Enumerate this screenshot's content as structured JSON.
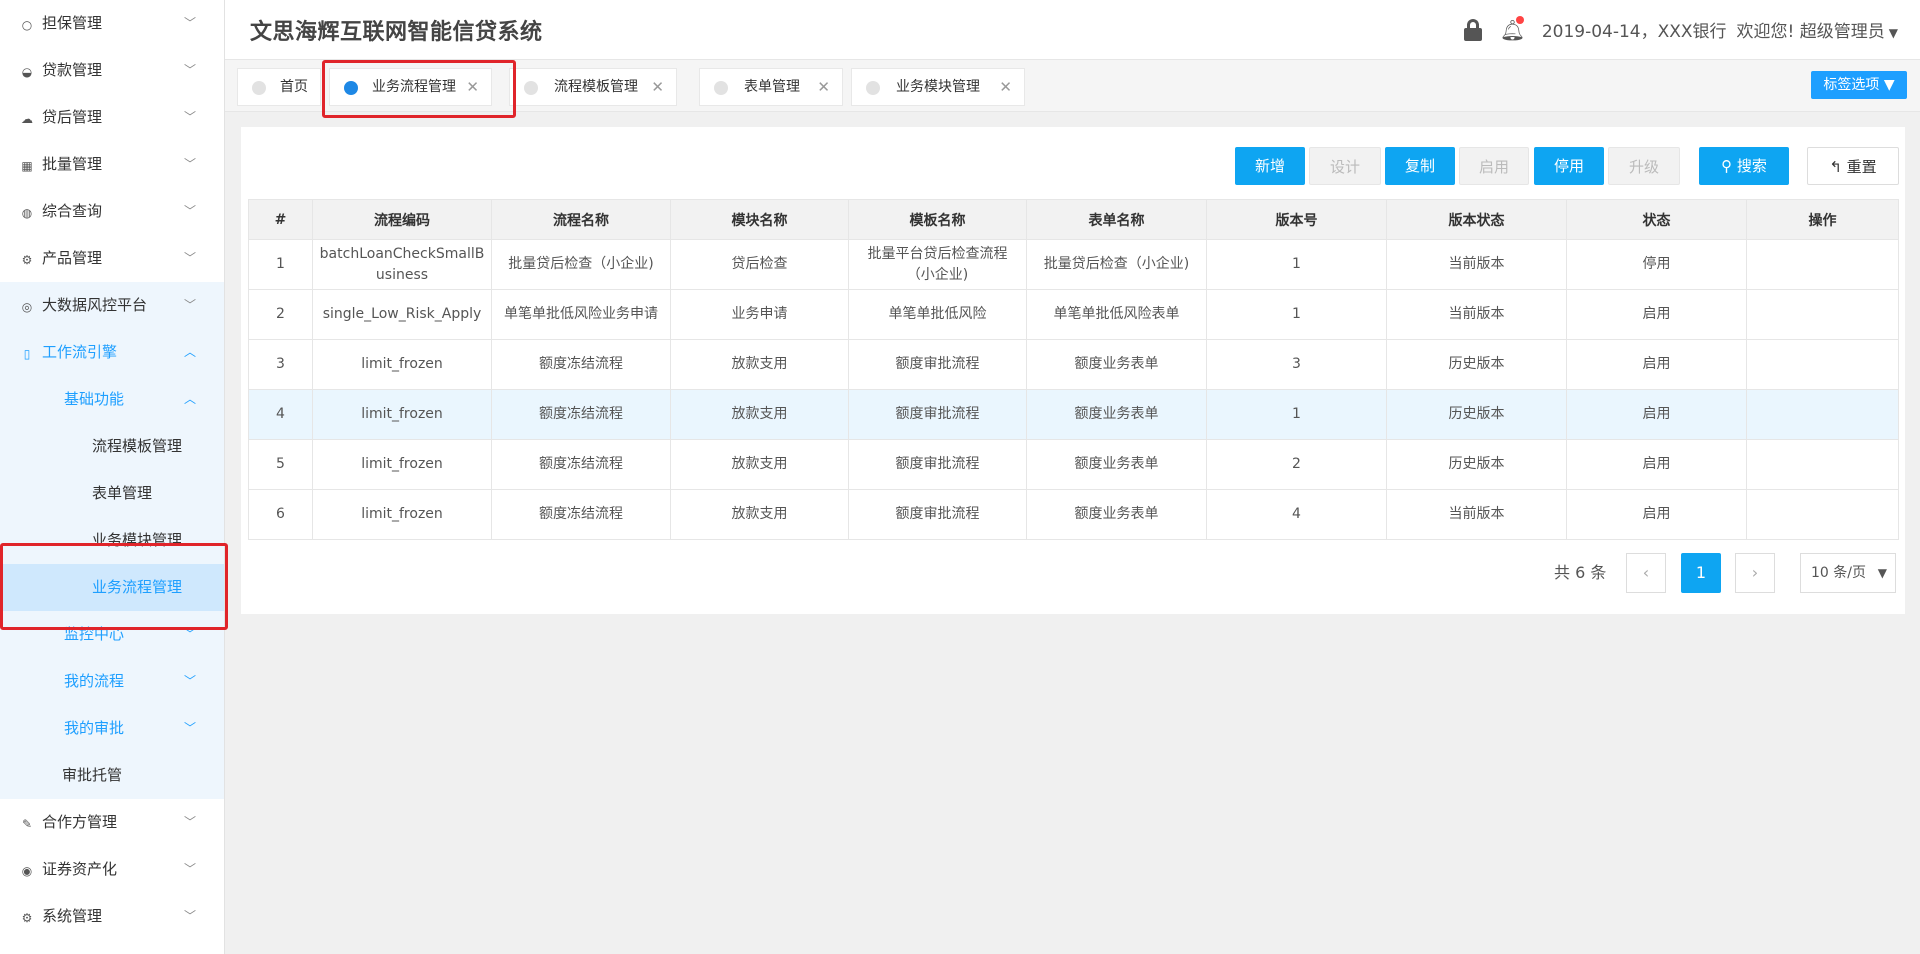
{
  "header": {
    "app_title": "文思海辉互联网智能信贷系统",
    "date_bank": "2019-04-14，XXX银行",
    "welcome": "欢迎您! 超级管理员"
  },
  "sidebar": {
    "items": [
      {
        "label": "担保管理",
        "icon": "circle-outline-icon"
      },
      {
        "label": "贷款管理",
        "icon": "half-circle-icon"
      },
      {
        "label": "贷后管理",
        "icon": "cloud-icon"
      },
      {
        "label": "批量管理",
        "icon": "grid-icon"
      },
      {
        "label": "综合查询",
        "icon": "globe-icon"
      },
      {
        "label": "产品管理",
        "icon": "gear-icon"
      },
      {
        "label": "大数据风控平台",
        "icon": "signal-icon"
      },
      {
        "label": "工作流引擎",
        "icon": "mobile-icon"
      },
      {
        "label": "基础功能"
      },
      {
        "label": "流程模板管理"
      },
      {
        "label": "表单管理"
      },
      {
        "label": "业务模块管理"
      },
      {
        "label": "业务流程管理"
      },
      {
        "label": "监控中心"
      },
      {
        "label": "我的流程"
      },
      {
        "label": "我的审批"
      },
      {
        "label": "审批托管"
      },
      {
        "label": "合作方管理",
        "icon": "brush-icon"
      },
      {
        "label": "证券资产化",
        "icon": "radio-icon"
      },
      {
        "label": "系统管理",
        "icon": "gear-icon"
      }
    ]
  },
  "tabs": [
    {
      "label": "首页"
    },
    {
      "label": "业务流程管理"
    },
    {
      "label": "流程模板管理"
    },
    {
      "label": "表单管理"
    },
    {
      "label": "业务模块管理"
    }
  ],
  "tab_options_label": "标签选项",
  "toolbar": {
    "add": "新增",
    "design": "设计",
    "copy": "复制",
    "enable": "启用",
    "disable": "停用",
    "upgrade": "升级",
    "search": "搜索",
    "reset": "重置"
  },
  "table": {
    "columns": [
      "#",
      "流程编码",
      "流程名称",
      "模块名称",
      "模板名称",
      "表单名称",
      "版本号",
      "版本状态",
      "状态",
      "操作"
    ],
    "rows": [
      [
        "1",
        "batchLoanCheckSmallBusiness",
        "批量贷后检查（小企业)",
        "贷后检查",
        "批量平台贷后检查流程（小企业)",
        "批量贷后检查（小企业)",
        "1",
        "当前版本",
        "停用",
        ""
      ],
      [
        "2",
        "single_Low_Risk_Apply",
        "单笔单批低风险业务申请",
        "业务申请",
        "单笔单批低风险",
        "单笔单批低风险表单",
        "1",
        "当前版本",
        "启用",
        ""
      ],
      [
        "3",
        "limit_frozen",
        "额度冻结流程",
        "放款支用",
        "额度审批流程",
        "额度业务表单",
        "3",
        "历史版本",
        "启用",
        ""
      ],
      [
        "4",
        "limit_frozen",
        "额度冻结流程",
        "放款支用",
        "额度审批流程",
        "额度业务表单",
        "1",
        "历史版本",
        "启用",
        ""
      ],
      [
        "5",
        "limit_frozen",
        "额度冻结流程",
        "放款支用",
        "额度审批流程",
        "额度业务表单",
        "2",
        "历史版本",
        "启用",
        ""
      ],
      [
        "6",
        "limit_frozen",
        "额度冻结流程",
        "放款支用",
        "额度审批流程",
        "额度业务表单",
        "4",
        "当前版本",
        "启用",
        ""
      ]
    ]
  },
  "pager": {
    "total": "共 6 条",
    "current": "1",
    "page_size": "10 条/页"
  }
}
